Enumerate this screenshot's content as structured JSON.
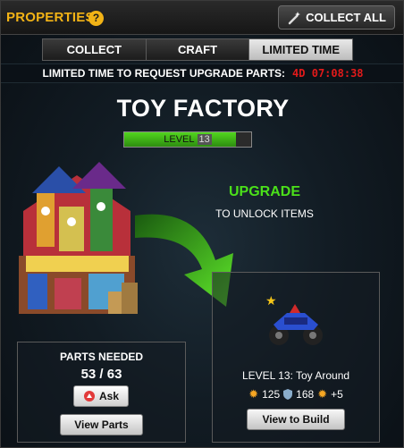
{
  "header": {
    "title": "PROPERTIES",
    "help_icon": "question-icon",
    "collect_all_label": "COLLECT ALL",
    "collect_all_icon": "magic-wand-icon"
  },
  "tabs": [
    {
      "label": "COLLECT",
      "active": false
    },
    {
      "label": "CRAFT",
      "active": false
    },
    {
      "label": "LIMITED TIME",
      "active": true
    }
  ],
  "timer": {
    "label": "LIMITED TIME TO REQUEST UPGRADE PARTS:",
    "value": "4D 07:08:38"
  },
  "building": {
    "name": "TOY FACTORY",
    "level_label": "LEVEL",
    "level": "13",
    "level_progress": 0.88
  },
  "upgrade": {
    "title": "UPGRADE",
    "subtitle": "TO UNLOCK ITEMS"
  },
  "parts": {
    "title": "PARTS NEEDED",
    "count": "53 / 63",
    "ask_label": "Ask",
    "view_label": "View Parts"
  },
  "reward": {
    "level_text": "LEVEL 13:  Toy Around",
    "stat_1": "125",
    "stat_2": "168",
    "stat_3": "+5",
    "view_label": "View to Build"
  },
  "colors": {
    "accent_gold": "#f2b316",
    "timer_red": "#e21a1a",
    "upgrade_green": "#4be01a"
  }
}
